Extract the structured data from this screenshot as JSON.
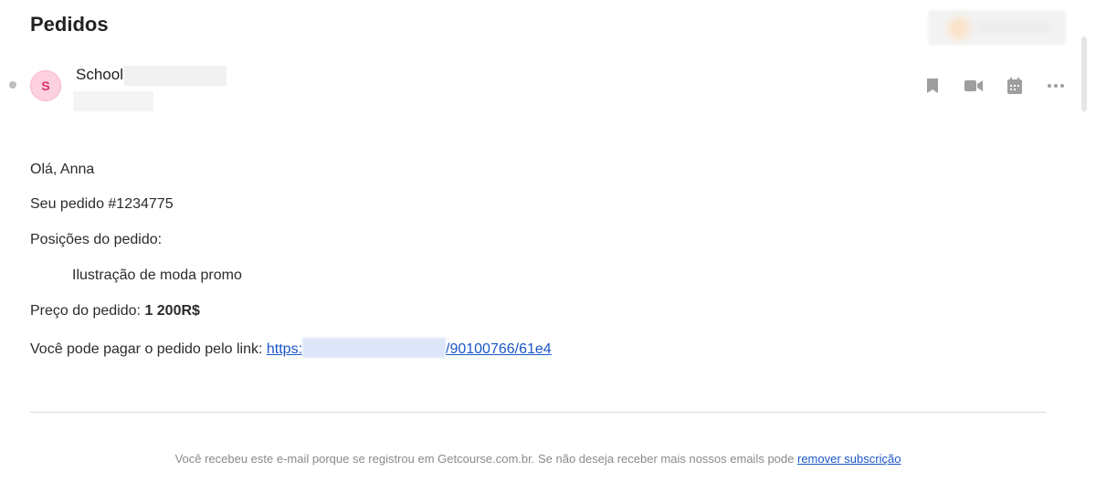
{
  "header": {
    "title": "Pedidos"
  },
  "sender": {
    "avatar_letter": "S",
    "name": "School"
  },
  "actions": [
    {
      "icon": "bookmark-icon"
    },
    {
      "icon": "video-icon"
    },
    {
      "icon": "calendar-icon"
    },
    {
      "icon": "more-icon"
    }
  ],
  "email": {
    "greeting": "Olá, Anna",
    "order_line": "Seu pedido #1234775",
    "positions_label": "Posições do pedido:",
    "item": "Ilustração de moda promo",
    "price_label": "Preço do pedido:",
    "price_value": "1 200R$",
    "pay_label": "Você pode pagar o pedido pelo link:",
    "link_start": "https:",
    "link_end": "/90100766/61e4"
  },
  "footer": {
    "text": "Você recebeu este e-mail porque se registrou em Getcourse.com.br. Se não deseja receber mais nossos emails pode",
    "unsubscribe_label": "remover subscrição"
  },
  "colors": {
    "link": "#1a56c7",
    "avatar_bg": "#fcd0e0",
    "avatar_text": "#d8336d",
    "icon": "#9e9e9e"
  }
}
